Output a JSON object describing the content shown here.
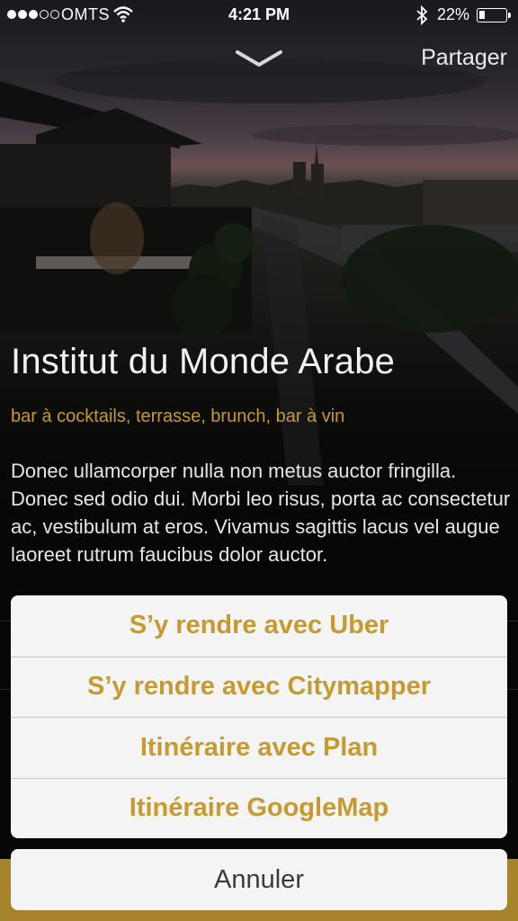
{
  "status_bar": {
    "carrier": "OMTS",
    "time": "4:21 PM",
    "battery": "22%",
    "battery_level": 0.22,
    "signal_bars_filled": 3,
    "signal_bars_total": 5,
    "icons": [
      "signal-dots-icon",
      "wifi-icon",
      "bluetooth-icon",
      "battery-icon"
    ]
  },
  "header": {
    "collapse_icon": "chevron-down-icon",
    "share_label": "Partager"
  },
  "venue": {
    "title": "Institut du Monde Arabe",
    "tags": "bar à cocktails, terrasse, brunch, bar à vin",
    "description": "Donec ullamcorper nulla non metus auctor fringilla. Donec sed odio dui. Morbi leo risus, porta ac consectetur ac, vestibulum at eros. Vivamus sagittis lacus vel augue laoreet rutrum faucibus dolor auctor."
  },
  "action_sheet": {
    "items": [
      "S’y rendre avec Uber",
      "S’y rendre avec Citymapper",
      "Itinéraire avec Plan",
      "Itinéraire GoogleMap"
    ],
    "cancel_label": "Annuler"
  },
  "colors": {
    "accent": "#c79a2f",
    "bottom_bar": "#a7832a",
    "sheet_background": "#f4f4f4",
    "cancel_text": "#3b3b3b"
  }
}
